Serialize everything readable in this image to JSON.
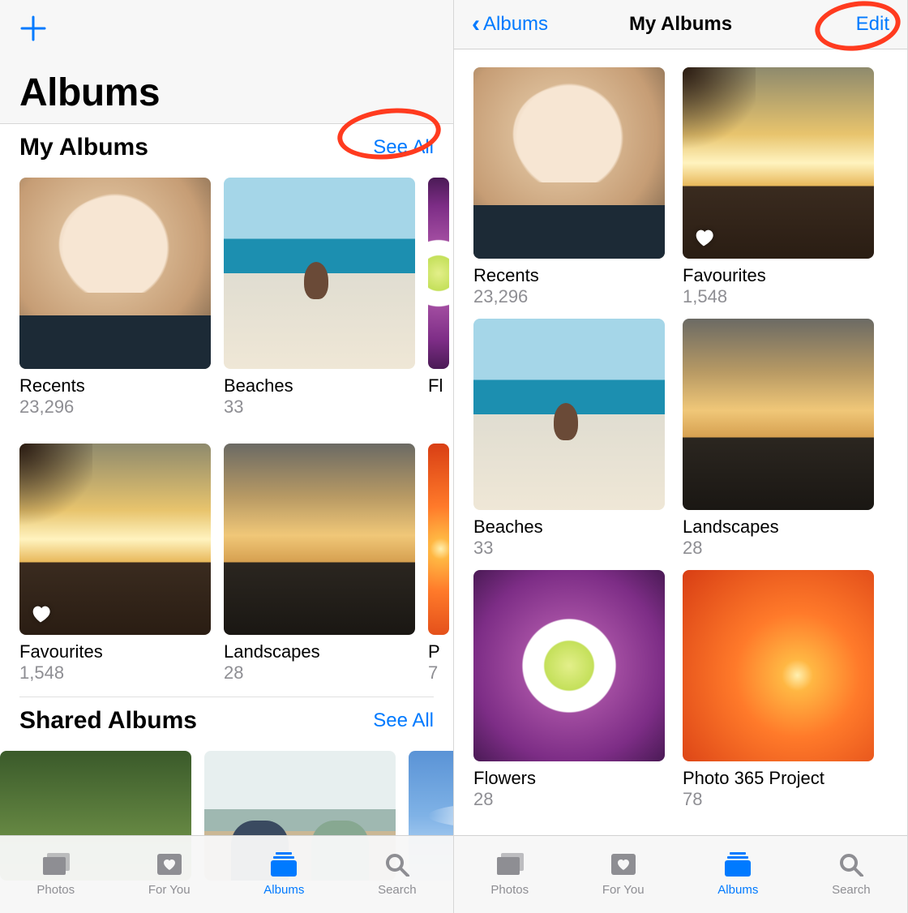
{
  "colors": {
    "accent": "#007aff",
    "annotation": "#ff3b1f",
    "inactive": "#8e8e93"
  },
  "screen1": {
    "title": "Albums",
    "add_label": "+",
    "my_albums": {
      "title": "My Albums",
      "see_all": "See All",
      "row1": [
        {
          "name": "Recents",
          "count": "23,296",
          "art": "art-portrait",
          "favourite": false
        },
        {
          "name": "Beaches",
          "count": "33",
          "art": "art-beach",
          "favourite": false
        },
        {
          "name": "Fl",
          "count": "",
          "art": "art-flower",
          "favourite": false
        }
      ],
      "row2": [
        {
          "name": "Favourites",
          "count": "1,548",
          "art": "art-sunset1",
          "favourite": true
        },
        {
          "name": "Landscapes",
          "count": "28",
          "art": "art-sunset2",
          "favourite": false
        },
        {
          "name": "P",
          "count": "7",
          "art": "art-orange",
          "favourite": false
        }
      ]
    },
    "shared_albums": {
      "title": "Shared Albums",
      "see_all": "See All",
      "items": [
        {
          "name": "",
          "count": "",
          "art": "art-green"
        },
        {
          "name": "",
          "count": "",
          "art": "art-kids"
        },
        {
          "name": "",
          "count": "",
          "art": "art-sky"
        },
        {
          "name": "",
          "count": "",
          "art": "art-flower"
        }
      ]
    }
  },
  "screen2": {
    "back_label": "Albums",
    "title": "My Albums",
    "edit_label": "Edit",
    "albums": [
      {
        "name": "Recents",
        "count": "23,296",
        "art": "art-portrait",
        "favourite": false
      },
      {
        "name": "Favourites",
        "count": "1,548",
        "art": "art-sunset1",
        "favourite": true
      },
      {
        "name": "Beaches",
        "count": "33",
        "art": "art-beach",
        "favourite": false
      },
      {
        "name": "Landscapes",
        "count": "28",
        "art": "art-sunset2",
        "favourite": false
      },
      {
        "name": "Flowers",
        "count": "28",
        "art": "art-flower",
        "favourite": false
      },
      {
        "name": "Photo 365 Project",
        "count": "78",
        "art": "art-orange",
        "favourite": false
      }
    ]
  },
  "tabbar": {
    "items": [
      {
        "label": "Photos",
        "icon": "stack-icon",
        "active": false
      },
      {
        "label": "For You",
        "icon": "heart-card-icon",
        "active": false
      },
      {
        "label": "Albums",
        "icon": "albums-icon",
        "active": true
      },
      {
        "label": "Search",
        "icon": "search-icon",
        "active": false
      }
    ]
  }
}
